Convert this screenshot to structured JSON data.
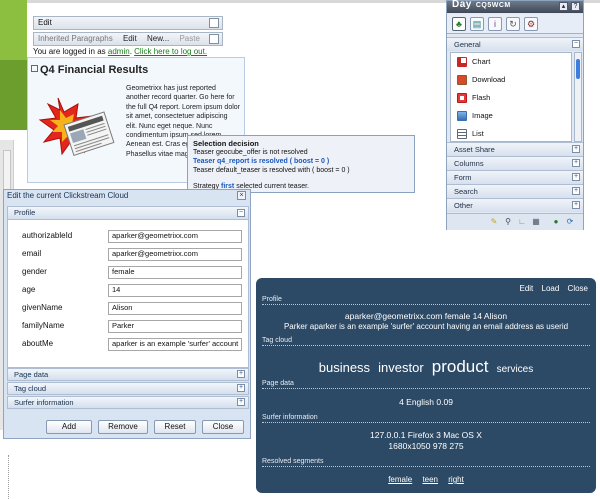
{
  "editbar": {
    "edit_label": "Edit",
    "inherited_label": "Inherited Paragraphs",
    "edit_btn": "Edit",
    "new_btn": "New...",
    "paste_btn": "Paste"
  },
  "login": {
    "prefix": "You are logged in as",
    "user": "admin",
    "logout": "Click here to log out."
  },
  "teaser": {
    "title": "Q4 Financial Results",
    "text": "Geometrixx has just reported another record quarter. Go here for the full Q4 report. Lorem ipsum dolor sit amet, consectetuer adipiscing elit. Nunc eget neque. Nunc condimentum ipsum sed lorem. Aenean est. Cras eget lorem. Phasellus vitae magna ut dictum."
  },
  "decision": {
    "heading": "Selection decision",
    "line1": "Teaser geocube_offer is not resolved",
    "line2": "Teaser q4_report is resolved ( boost = 0 )",
    "line3": "Teaser default_teaser is resolved with ( boost = 0 )",
    "strategy_prefix": "Strategy",
    "strategy_name": "first",
    "strategy_suffix": "selected current teaser."
  },
  "sidekick": {
    "logo": "Day",
    "product": "CQ5WCM",
    "sections": {
      "general": "General",
      "asset_share": "Asset Share",
      "columns": "Columns",
      "form": "Form",
      "search": "Search",
      "other": "Other"
    },
    "components": [
      {
        "label": "Chart",
        "icon": "chart-icon",
        "color": "#c62828"
      },
      {
        "label": "Download",
        "icon": "download-icon",
        "color": "#8a5a2a"
      },
      {
        "label": "Flash",
        "icon": "flash-icon",
        "color": "#b71c1c"
      },
      {
        "label": "Image",
        "icon": "image-icon",
        "color": "#3a6fb0"
      },
      {
        "label": "List",
        "icon": "list-icon",
        "color": "#5a6a7a"
      }
    ]
  },
  "clickstream_editor": {
    "title": "Edit the current Clickstream Cloud",
    "profile_header": "Profile",
    "fields": [
      {
        "label": "authorizableId",
        "value": "aparker@geometrixx.com"
      },
      {
        "label": "email",
        "value": "aparker@geometrixx.com"
      },
      {
        "label": "gender",
        "value": "female"
      },
      {
        "label": "age",
        "value": "14"
      },
      {
        "label": "givenName",
        "value": "Alison"
      },
      {
        "label": "familyName",
        "value": "Parker"
      },
      {
        "label": "aboutMe",
        "value": "aparker is an example 'surfer' account"
      }
    ],
    "sections": {
      "page_data": "Page data",
      "tag_cloud": "Tag cloud",
      "surfer_information": "Surfer information"
    },
    "buttons": {
      "add": "Add",
      "remove": "Remove",
      "reset": "Reset",
      "close": "Close"
    }
  },
  "dark_cloud": {
    "actions": {
      "edit": "Edit",
      "load": "Load",
      "close": "Close"
    },
    "profile_header": "Profile",
    "profile_line1": "aparker@geometrixx.com   female   14   Alison",
    "profile_line2": "Parker   aparker is an example 'surfer' account having an email address as userid",
    "tag_cloud_header": "Tag cloud",
    "tags": [
      {
        "label": "business",
        "size": 13
      },
      {
        "label": "investor",
        "size": 13
      },
      {
        "label": "product",
        "size": 17
      },
      {
        "label": "services",
        "size": 10
      }
    ],
    "page_data_header": "Page data",
    "page_data_line": "4   English   0.09",
    "surfer_header": "Surfer information",
    "surfer_line1": "127.0.0.1   Firefox 3   Mac OS X",
    "surfer_line2": "1680x1050   978   275",
    "segments_header": "Resolved segments",
    "segments": [
      "female",
      "teen",
      "right"
    ]
  }
}
